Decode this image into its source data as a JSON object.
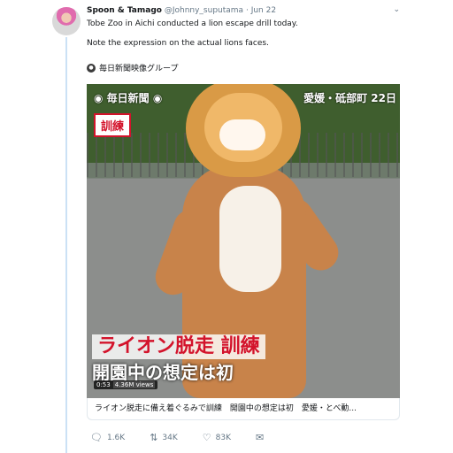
{
  "tweet": {
    "display_name": "Spoon & Tamago",
    "handle": "@Johnny_suputama",
    "separator": "·",
    "date": "Jun 22",
    "text_line1": "Tobe Zoo in Aichi conducted a lion escape drill today.",
    "text_line2": "Note the expression on the actual lions faces.",
    "source_label": "毎日新聞映像グループ"
  },
  "video": {
    "logo_text": "◉ 毎日新聞 ◉",
    "location_text": "愛媛・砥部町 22日",
    "badge_text": "訓練",
    "headline": "ライオン脱走 訓練",
    "subline": "開園中の想定は初",
    "duration": "0:53",
    "views": "4.36M views"
  },
  "card": {
    "caption": "ライオン脱走に備え着ぐるみで訓練　開園中の想定は初　愛媛・とべ動..."
  },
  "actions": {
    "reply_count": "1.6K",
    "retweet_count": "34K",
    "like_count": "83K"
  },
  "icons": {
    "reply": "reply-icon",
    "retweet": "retweet-icon",
    "like": "heart-icon",
    "more": "chevron-down-icon"
  },
  "colors": {
    "accent_red": "#d3132b",
    "thread_line": "#cbe1f5",
    "meta_gray": "#657786"
  }
}
